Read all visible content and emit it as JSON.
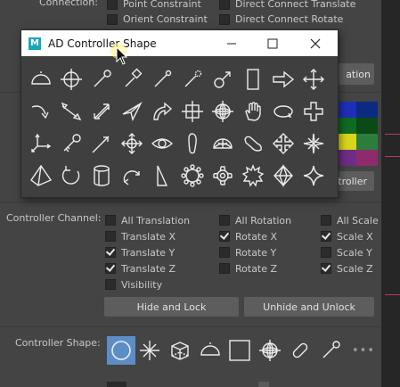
{
  "top_section": {
    "title_partial": "Connection:",
    "left_items": [
      {
        "label": "Point Constraint",
        "checked": false
      },
      {
        "label": "Orient Constraint",
        "checked": false
      }
    ],
    "right_items": [
      {
        "label": "Direct Connect Translate",
        "checked": false
      },
      {
        "label": "Direct Connect Rotate",
        "checked": false
      }
    ],
    "hidden_button_label_partial": "ation"
  },
  "middle_section": {
    "button_partial": "troller"
  },
  "colors": {
    "swatches": [
      "#1d2fb8",
      "#0b2a80",
      "#0f6b22",
      "#0b4a16",
      "#d7d61a",
      "#2c7d3b",
      "#6f2d86",
      "#8d2c6c"
    ],
    "accent_pink": "#c0306a"
  },
  "popup": {
    "title": "AD Controller Shape",
    "app_icon": "M",
    "minimize_icon": "minimize-icon",
    "maximize_icon": "maximize-icon",
    "close_icon": "close-icon",
    "shapes": [
      "half-circle",
      "circle-cross",
      "pin",
      "lollipop-square",
      "pin-thin",
      "wand",
      "male-symbol",
      "rectangle",
      "arrow-right",
      "four-arrow",
      "curved-arrow",
      "diagonal-arrow",
      "double-arrow",
      "paper-plane",
      "curved-thick-arrow",
      "square-cross",
      "sphere-cross",
      "hand",
      "rotate-ring",
      "plus",
      "axes",
      "key",
      "needle",
      "four-arrow-circle",
      "eye",
      "foot",
      "half-sphere",
      "shoe",
      "four-arrow-diamond",
      "star-burst",
      "pyramid",
      "rotate-circle",
      "cylinder",
      "arc-arrow",
      "triangle-flag",
      "gear-round",
      "gear",
      "gear-star",
      "octahedron",
      "star-four"
    ]
  },
  "channels": {
    "label": "Controller Channel:",
    "col1": [
      {
        "label": "All Translation",
        "checked": false
      },
      {
        "label": "Translate X",
        "checked": false
      },
      {
        "label": "Translate Y",
        "checked": true
      },
      {
        "label": "Translate Z",
        "checked": true
      },
      {
        "label": "Visibility",
        "checked": false
      }
    ],
    "col2": [
      {
        "label": "All Rotation",
        "checked": false
      },
      {
        "label": "Rotate X",
        "checked": true
      },
      {
        "label": "Rotate Y",
        "checked": false
      },
      {
        "label": "Rotate Z",
        "checked": false
      }
    ],
    "col3": [
      {
        "label": "All Scale",
        "checked": false
      },
      {
        "label": "Scale X",
        "checked": true
      },
      {
        "label": "Scale Y",
        "checked": false
      },
      {
        "label": "Scale Z",
        "checked": true
      }
    ],
    "hide_lock_button": "Hide and Lock",
    "unhide_unlock_button": "Unhide and Unlock"
  },
  "controller_shape": {
    "label": "Controller Shape:",
    "shapes": [
      "circle",
      "asterisk",
      "cube",
      "half-circle",
      "square",
      "sphere-cross",
      "capsule",
      "pin"
    ],
    "more": "•••"
  }
}
